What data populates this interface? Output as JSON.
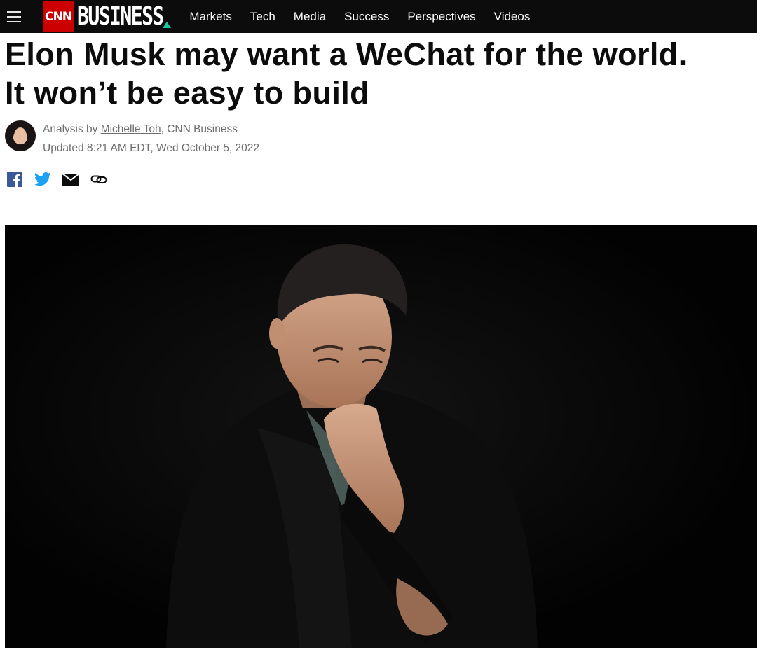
{
  "nav": {
    "brand_cnn": "CNN",
    "brand_section": "BUSINESS",
    "links": [
      "Markets",
      "Tech",
      "Media",
      "Success",
      "Perspectives",
      "Videos"
    ]
  },
  "article": {
    "headline_line1": "Elon Musk may want a WeChat for the world.",
    "headline_line2": "It won’t be easy to build",
    "byline_prefix": "Analysis by ",
    "author": "Michelle Toh",
    "byline_suffix": ", CNN Business",
    "updated": "Updated 8:21 AM EDT, Wed October 5, 2022"
  },
  "share": {
    "icons": [
      "facebook-icon",
      "twitter-icon",
      "email-icon",
      "link-icon"
    ]
  },
  "colors": {
    "nav_bg": "#0c0c0c",
    "cnn_red": "#cc0000",
    "accent_teal": "#19c6a1",
    "facebook_blue": "#3b5998",
    "twitter_blue": "#1da1f2"
  }
}
